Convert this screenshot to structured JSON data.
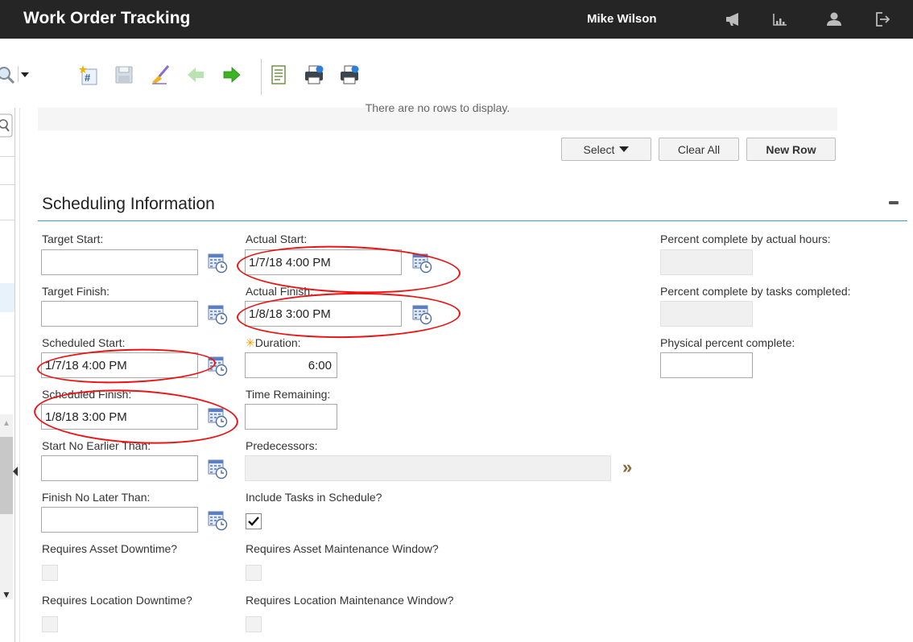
{
  "header": {
    "title": "Work Order Tracking",
    "user": "Mike Wilson",
    "icons": [
      "megaphone-icon",
      "reports-icon",
      "profile-icon",
      "sign-out-icon"
    ]
  },
  "toolbar": {
    "icons": [
      "search-icon",
      "new-work-order-icon",
      "save-icon",
      "clear-changes-icon",
      "previous-record-icon",
      "next-record-icon",
      "view-history-icon",
      "print-icon",
      "print-work-pack-icon"
    ]
  },
  "table": {
    "empty_message": "There are no rows to display.",
    "select_label": "Select",
    "clear_all_label": "Clear All",
    "new_row_label": "New Row"
  },
  "section": {
    "title": "Scheduling Information"
  },
  "fields": {
    "target_start": {
      "label": "Target Start:",
      "value": ""
    },
    "target_finish": {
      "label": "Target Finish:",
      "value": ""
    },
    "scheduled_start": {
      "label": "Scheduled Start:",
      "value": "1/7/18 4:00 PM"
    },
    "scheduled_finish": {
      "label": "Scheduled Finish:",
      "value": "1/8/18 3:00 PM"
    },
    "start_no_earlier": {
      "label": "Start No Earlier Than:",
      "value": ""
    },
    "finish_no_later": {
      "label": "Finish No Later Than:",
      "value": ""
    },
    "actual_start": {
      "label": "Actual Start:",
      "value": "1/7/18 4:00 PM"
    },
    "actual_finish": {
      "label": "Actual Finish:",
      "value": "1/8/18 3:00 PM"
    },
    "duration": {
      "label": "Duration:",
      "value": "6:00",
      "required_mark": "✳"
    },
    "time_remaining": {
      "label": "Time Remaining:",
      "value": ""
    },
    "predecessors": {
      "label": "Predecessors:",
      "value": ""
    },
    "include_tasks": {
      "label": "Include Tasks in Schedule?",
      "checked": true
    },
    "req_asset_downtime": {
      "label": "Requires Asset Downtime?",
      "checked": false
    },
    "req_asset_window": {
      "label": "Requires Asset Maintenance Window?",
      "checked": false
    },
    "req_location_downtime": {
      "label": "Requires Location Downtime?",
      "checked": false
    },
    "req_location_window": {
      "label": "Requires Location Maintenance Window?",
      "checked": false
    },
    "pct_actual_hours": {
      "label": "Percent complete by actual hours:",
      "value": ""
    },
    "pct_tasks": {
      "label": "Percent complete by tasks completed:",
      "value": ""
    },
    "pct_physical": {
      "label": "Physical percent complete:",
      "value": ""
    }
  },
  "colors": {
    "header_bg": "#252525",
    "section_rule": "#3b9ecf",
    "annotation": "#ee1111",
    "required": "#f0a000"
  }
}
